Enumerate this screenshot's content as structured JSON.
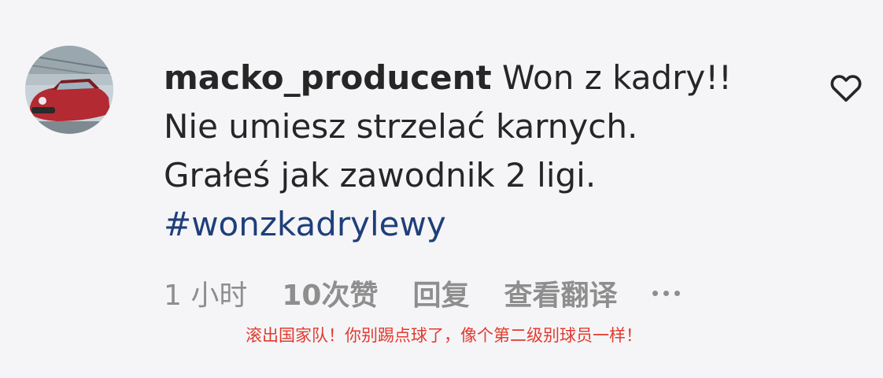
{
  "comment": {
    "username": "macko_producent",
    "text_line1": " Won z kadry!!",
    "text_line2": "Nie umiesz strzelać karnych.",
    "text_line3": "Grałeś jak zawodnik 2 ligi.",
    "hashtag": "#wonzkadrylewy",
    "time": "1 小时",
    "likes": "10次赞",
    "reply_label": "回复",
    "translate_label": "查看翻译"
  },
  "caption": "滚出国家队！你别踢点球了，像个第二级别球员一样！",
  "icons": {
    "like": "heart-icon",
    "more": "more-options-icon",
    "avatar": "avatar"
  },
  "colors": {
    "background": "#f5f5f7",
    "text": "#262626",
    "muted": "#8e8e8e",
    "hashtag": "#1f3f7a",
    "caption": "#e23a2f"
  }
}
